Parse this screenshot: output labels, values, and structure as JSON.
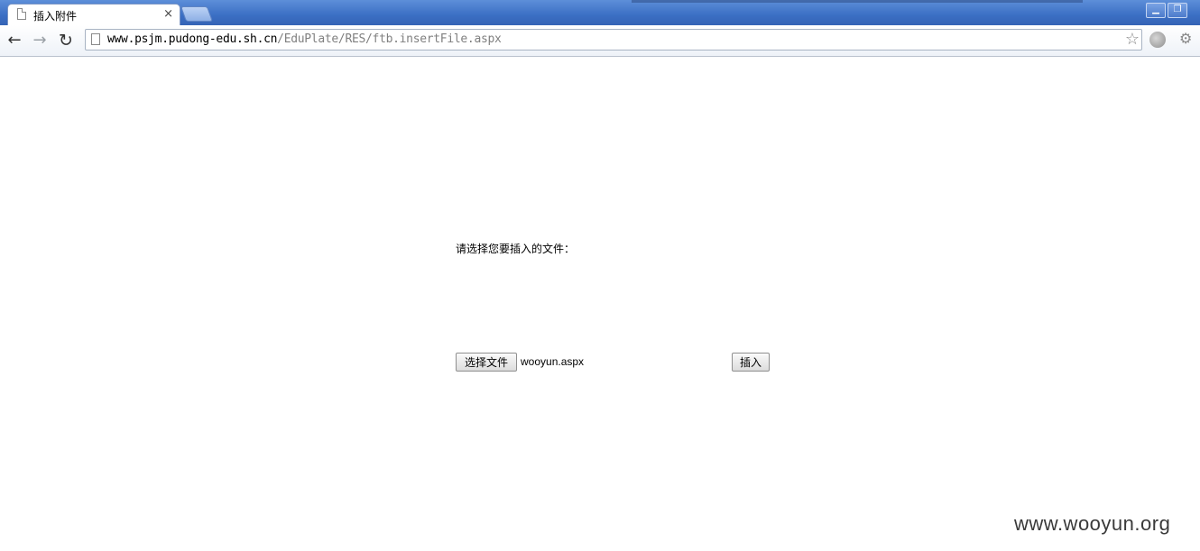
{
  "tab": {
    "title": "插入附件",
    "close_glyph": "×"
  },
  "window": {
    "minimize_glyph": "▁",
    "restore_glyph": "❐"
  },
  "toolbar": {
    "back_glyph": "←",
    "forward_glyph": "→",
    "reload_glyph": "↻",
    "url_host": "www.psjm.pudong-edu.sh.cn",
    "url_path": "/EduPlate/RES/ftb.insertFile.aspx",
    "star_glyph": "☆",
    "wrench_glyph": "⚙"
  },
  "page": {
    "prompt": "请选择您要插入的文件：",
    "choose_file_label": "选择文件",
    "selected_file": "wooyun.aspx",
    "insert_label": "插入"
  },
  "watermark": "www.wooyun.org",
  "colors": {
    "titlebar": "#3b6fc4",
    "url_path": "#808080"
  }
}
